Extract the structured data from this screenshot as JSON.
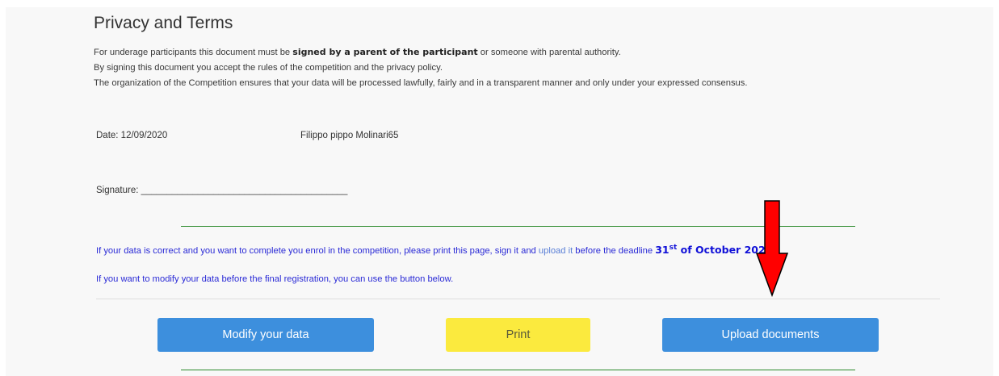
{
  "page": {
    "title": "Privacy and Terms",
    "intro_line1_pre": "For underage participants this document must be ",
    "intro_line1_bold": "signed by a parent of the participant",
    "intro_line1_post": " or someone with parental authority.",
    "intro_line2": "By signing this document you accept the rules of the competition and the privacy policy.",
    "intro_line3": "The organization of the Competition ensures that your data will be processed lawfully, fairly and in a transparent manner and only under your expressed consensus."
  },
  "form": {
    "date": "Date: 12/09/2020",
    "name": "Filippo pippo Molinari65",
    "signature": "Signature: ________________________________________"
  },
  "notes": {
    "enrol_pre": "If your data is correct and you want to complete you enrol in the competition, please print this page, sign it and ",
    "enrol_link": "upload it",
    "enrol_mid": " before the deadline ",
    "deadline_day": "31",
    "deadline_suffix": "st",
    "deadline_rest": " of October 2020",
    "enrol_end": " .",
    "modify": "If you want to modify your data before the final registration, you can use the button below."
  },
  "buttons": {
    "modify": "Modify your data",
    "print": "Print",
    "upload": "Upload documents"
  },
  "colors": {
    "accent_blue": "#3d8fdd",
    "print_yellow": "#fbea3e",
    "annotation_arrow": "#ff0000"
  }
}
